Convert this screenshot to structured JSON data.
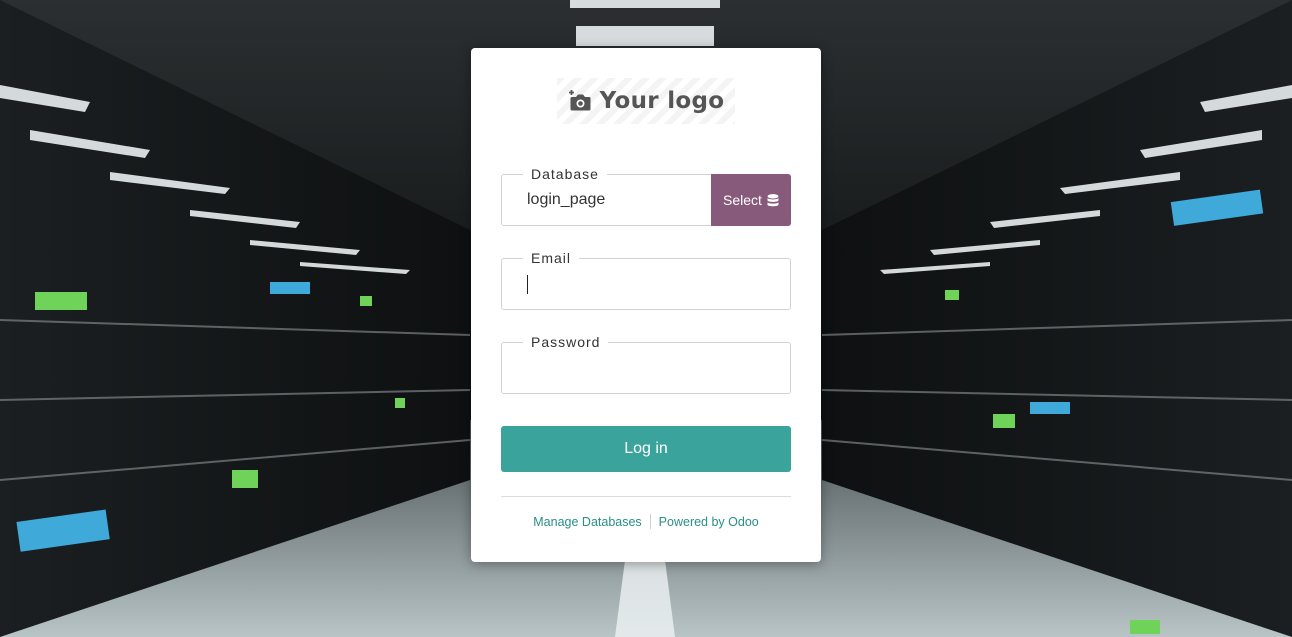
{
  "logo": {
    "text": "Your logo",
    "icon": "camera-plus-icon"
  },
  "form": {
    "database": {
      "label": "Database",
      "value": "login_page",
      "select_label": "Select",
      "select_icon": "database-icon"
    },
    "email": {
      "label": "Email",
      "value": ""
    },
    "password": {
      "label": "Password",
      "value": ""
    },
    "login_label": "Log in"
  },
  "footer": {
    "manage_databases": "Manage Databases",
    "powered_by": "Powered by Odoo"
  },
  "colors": {
    "primary": "#3aa39b",
    "select": "#875a7b",
    "link": "#2a8f88"
  }
}
